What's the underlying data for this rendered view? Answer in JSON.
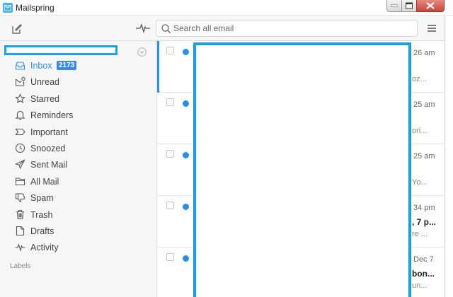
{
  "window": {
    "title": "Mailspring"
  },
  "toolbar": {
    "search_placeholder": "Search all email"
  },
  "sidebar": {
    "folders": [
      {
        "label": "Inbox",
        "count": "2173",
        "icon": "inbox-icon",
        "active": true
      },
      {
        "label": "Unread",
        "icon": "unread-icon"
      },
      {
        "label": "Starred",
        "icon": "star-icon"
      },
      {
        "label": "Reminders",
        "icon": "bell-icon"
      },
      {
        "label": "Important",
        "icon": "important-icon"
      },
      {
        "label": "Snoozed",
        "icon": "clock-icon"
      },
      {
        "label": "Sent Mail",
        "icon": "send-icon"
      },
      {
        "label": "All Mail",
        "icon": "folder-icon"
      },
      {
        "label": "Spam",
        "icon": "thumbs-down-icon"
      },
      {
        "label": "Trash",
        "icon": "trash-icon"
      },
      {
        "label": "Drafts",
        "icon": "draft-icon"
      },
      {
        "label": "Activity",
        "icon": "activity-icon"
      }
    ],
    "labels_heading": "Labels"
  },
  "messages": [
    {
      "time": "26 am",
      "subject": "",
      "snippet": "oz..."
    },
    {
      "time": "25 am",
      "subject": "",
      "snippet": "ori..."
    },
    {
      "time": "25 am",
      "subject": "",
      "snippet": "Yo..."
    },
    {
      "time": "34 pm",
      "subject": ", 7 p...",
      "snippet": "re ..."
    },
    {
      "time": "Dec 7",
      "subject": "bon...",
      "snippet": "un..."
    }
  ],
  "colors": {
    "accent": "#2c8fe0",
    "redaction": "#1a9fe0",
    "badge": "#3d8be6"
  }
}
